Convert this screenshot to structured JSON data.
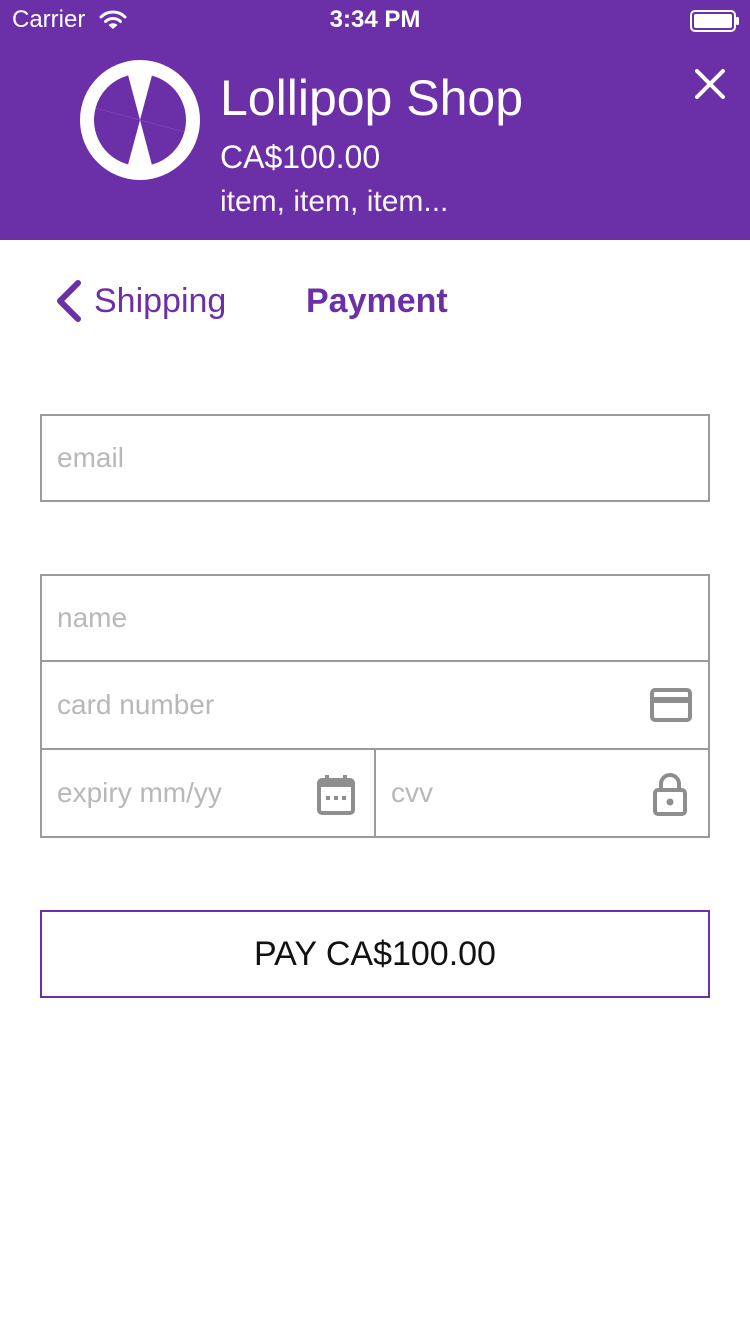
{
  "status_bar": {
    "carrier": "Carrier",
    "time": "3:34 PM"
  },
  "header": {
    "title": "Lollipop Shop",
    "price": "CA$100.00",
    "items": "item, item, item..."
  },
  "nav": {
    "back_label": "Shipping",
    "current": "Payment"
  },
  "form": {
    "email_placeholder": "email",
    "name_placeholder": "name",
    "card_placeholder": "card number",
    "expiry_placeholder": "expiry mm/yy",
    "cvv_placeholder": "cvv"
  },
  "pay_button_label": "PAY CA$100.00",
  "colors": {
    "brand": "#6b2fa7",
    "field_border": "#9b9b9b",
    "placeholder": "#b8b8b8",
    "icon": "#8e8e8e"
  },
  "icons": {
    "wifi": "wifi-icon",
    "battery": "battery-icon",
    "logo": "pinwheel-logo",
    "close": "close-icon",
    "back": "chevron-left-icon",
    "card": "credit-card-icon",
    "calendar": "calendar-icon",
    "lock": "lock-icon"
  }
}
